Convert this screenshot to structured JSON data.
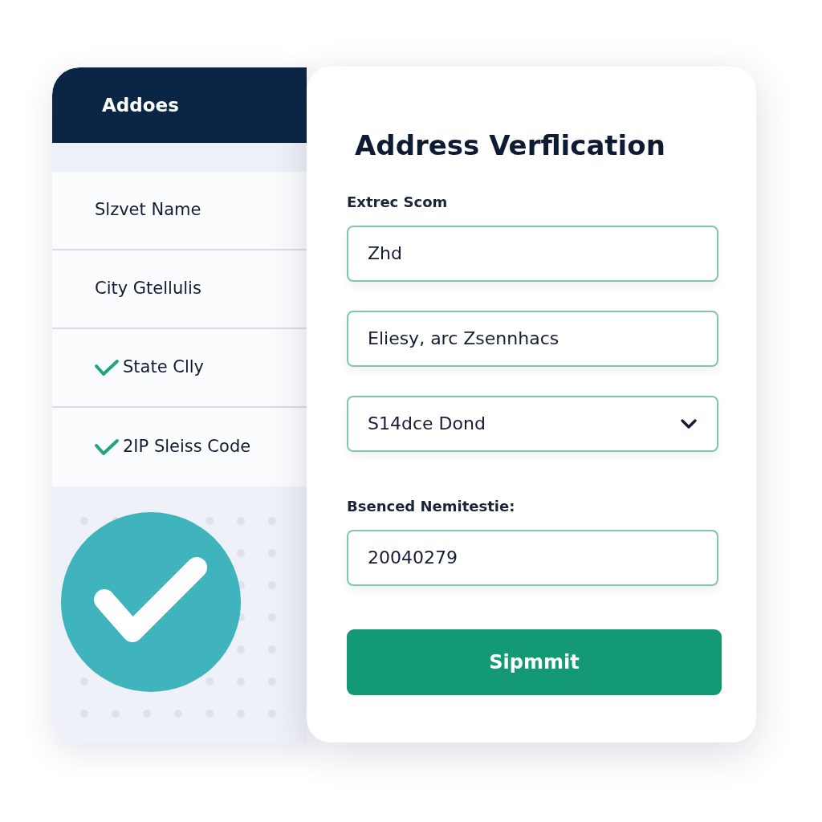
{
  "side_panel": {
    "title": "Addoes",
    "items": [
      {
        "label": "Slzvet Name",
        "checked": false
      },
      {
        "label": "City Gtellulis",
        "checked": false
      },
      {
        "label": "State Clly",
        "checked": true
      },
      {
        "label": "2IP Sleiss Code",
        "checked": true
      }
    ]
  },
  "form": {
    "title": "Address Verflication",
    "fields": [
      {
        "kind": "text",
        "label": "Extrec Scom",
        "value": "Zhd"
      },
      {
        "kind": "text",
        "value": "Eliesy, arc Zsennhacs"
      },
      {
        "kind": "select",
        "value": "S14dce Dond"
      },
      {
        "kind": "text",
        "label": "Bsenced Nemitestie:",
        "value": "20040279"
      }
    ],
    "submit": "Sipmmit"
  }
}
